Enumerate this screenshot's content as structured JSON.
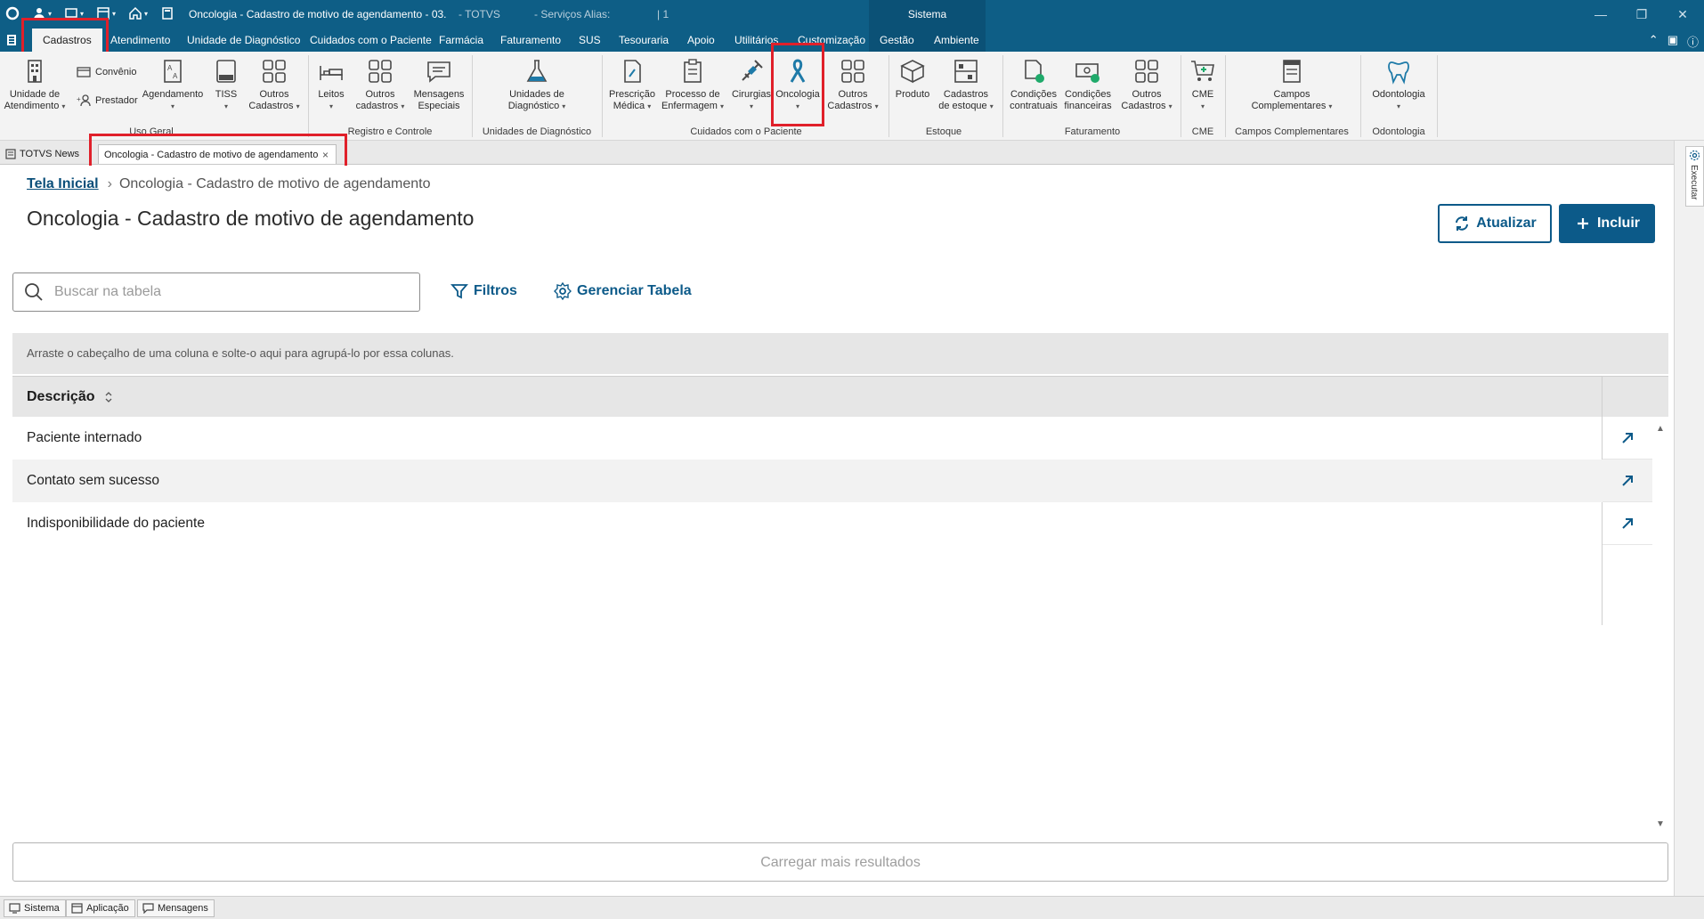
{
  "titlebar": {
    "window_title": "Oncologia - Cadastro de motivo de agendamento - 03.",
    "product": "- TOTVS",
    "services": "- Serviços  Alias:",
    "number": "| 1",
    "sistema_tab": "Sistema"
  },
  "menu": {
    "tabs": [
      "Cadastros",
      "Atendimento",
      "Unidade de Diagnóstico",
      "Cuidados com o Paciente",
      "Farmácia",
      "Faturamento",
      "SUS",
      "Tesouraria",
      "Apoio",
      "Utilitários",
      "Customização",
      "Gestão",
      "Ambiente"
    ]
  },
  "ribbon": {
    "unidade_atendimento": "Unidade de\nAtendimento",
    "convenio": "Convênio",
    "prestador": "Prestador",
    "agendamento": "Agendamento",
    "tiss": "TISS",
    "outros_cadastros_1": "Outros\nCadastros",
    "uso_geral": "Uso Geral",
    "leitos": "Leitos",
    "outros_cadastros_2": "Outros\ncadastros",
    "mensagens_especiais": "Mensagens\nEspeciais",
    "registro_controle": "Registro e Controle",
    "unidades_diagnostico": "Unidades de\nDiagnóstico",
    "grp_unidades_diagnostico": "Unidades de Diagnóstico",
    "prescricao_medica": "Prescrição\nMédica",
    "processo_enfermagem": "Processo de\nEnfermagem",
    "cirurgias": "Cirurgias",
    "oncologia": "Oncologia",
    "outros_cadastros_3": "Outros\nCadastros",
    "grp_cuidados": "Cuidados com o Paciente",
    "produto": "Produto",
    "cadastros_estoque": "Cadastros\nde estoque",
    "grp_estoque": "Estoque",
    "condicoes_contratuais": "Condições\ncontratuais",
    "condicoes_financeiras": "Condições\nfinanceiras",
    "outros_cadastros_4": "Outros\nCadastros",
    "grp_faturamento": "Faturamento",
    "cme": "CME",
    "grp_cme": "CME",
    "campos_complementares": "Campos\nComplementares",
    "grp_campos": "Campos Complementares",
    "odontologia": "Odontologia",
    "grp_odontologia": "Odontologia"
  },
  "doctabs": {
    "news": "TOTVS News",
    "current": "Oncologia - Cadastro de motivo de agendamento",
    "close": "×"
  },
  "side_panel": {
    "label": "Executar"
  },
  "page": {
    "breadcrumb_home": "Tela Inicial",
    "breadcrumb_current": "Oncologia - Cadastro de motivo de agendamento",
    "title": "Oncologia - Cadastro de motivo de agendamento",
    "btn_refresh": "Atualizar",
    "btn_add": "Incluir",
    "search_placeholder": "Buscar na tabela",
    "filters": "Filtros",
    "manage_table": "Gerenciar Tabela",
    "group_hint": "Arraste o cabeçalho de uma coluna e solte-o aqui para agrupá-lo por essa colunas.",
    "column_header": "Descrição",
    "rows": [
      "Paciente internado",
      "Contato sem sucesso",
      "Indisponibilidade do paciente"
    ],
    "load_more": "Carregar mais resultados"
  },
  "statusbar": {
    "sistema": "Sistema",
    "aplicacao": "Aplicação",
    "mensagens": "Mensagens"
  },
  "colors": {
    "brand": "#0e5e86",
    "primary_button": "#0c5a89",
    "highlight": "#e0202a"
  }
}
